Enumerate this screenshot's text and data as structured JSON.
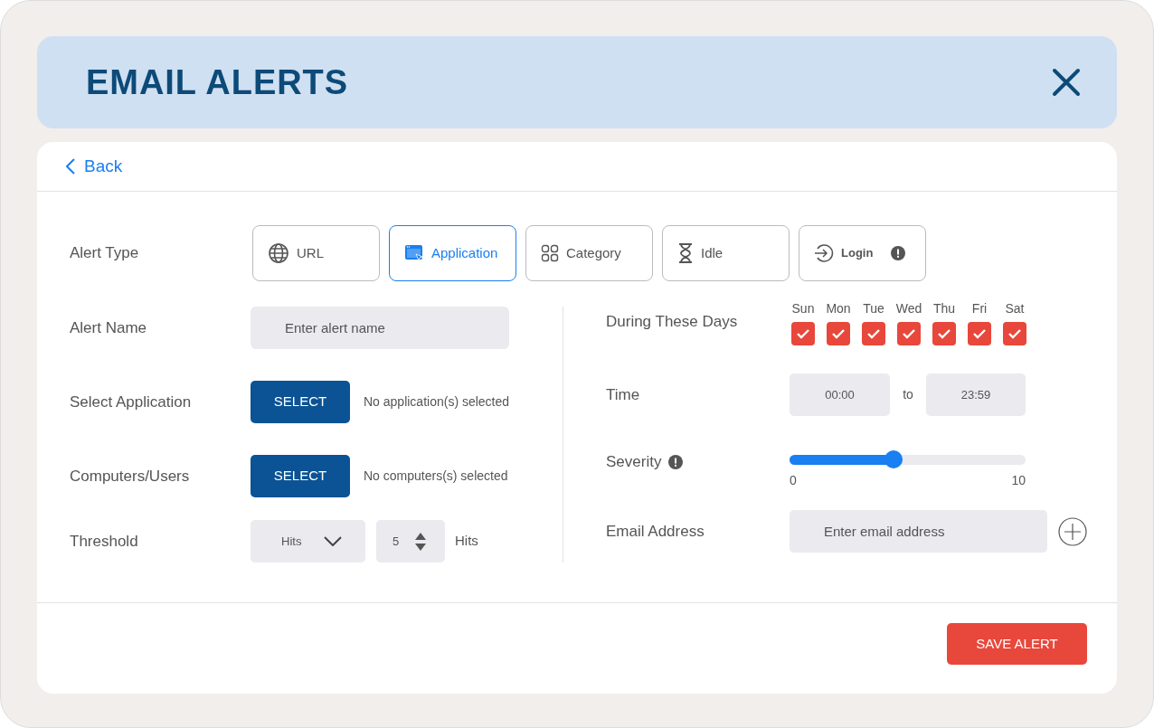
{
  "header": {
    "title": "EMAIL ALERTS"
  },
  "back": {
    "label": "Back"
  },
  "alert_type": {
    "label": "Alert Type",
    "options": [
      {
        "kind": "globe",
        "label": "URL",
        "selected": false,
        "info": false
      },
      {
        "kind": "window",
        "label": "Application",
        "selected": true,
        "info": false
      },
      {
        "kind": "grid",
        "label": "Category",
        "selected": false,
        "info": false
      },
      {
        "kind": "hourglass",
        "label": "Idle",
        "selected": false,
        "info": false
      },
      {
        "kind": "login",
        "label": "Login",
        "selected": false,
        "info": true
      }
    ]
  },
  "alert_name": {
    "label": "Alert Name",
    "placeholder": "Enter alert name"
  },
  "select_application": {
    "label": "Select Application",
    "button": "SELECT",
    "status": "No application(s) selected"
  },
  "computers_users": {
    "label": "Computers/Users",
    "button": "SELECT",
    "status": "No computers(s) selected"
  },
  "threshold": {
    "label": "Threshold",
    "unit_dropdown": "Hits",
    "count": "5",
    "suffix": "Hits"
  },
  "days": {
    "label": "During These Days",
    "items": [
      {
        "label": "Sun",
        "checked": true
      },
      {
        "label": "Mon",
        "checked": true
      },
      {
        "label": "Tue",
        "checked": true
      },
      {
        "label": "Wed",
        "checked": true
      },
      {
        "label": "Thu",
        "checked": true
      },
      {
        "label": "Fri",
        "checked": true
      },
      {
        "label": "Sat",
        "checked": true
      }
    ]
  },
  "time": {
    "label": "Time",
    "from": "00:00",
    "separator": "to",
    "to": "23:59"
  },
  "severity": {
    "label": "Severity",
    "level": 0.44,
    "min": "0",
    "max": "10"
  },
  "email": {
    "label": "Email Address",
    "placeholder": "Enter email address"
  },
  "save_button": "SAVE ALERT"
}
